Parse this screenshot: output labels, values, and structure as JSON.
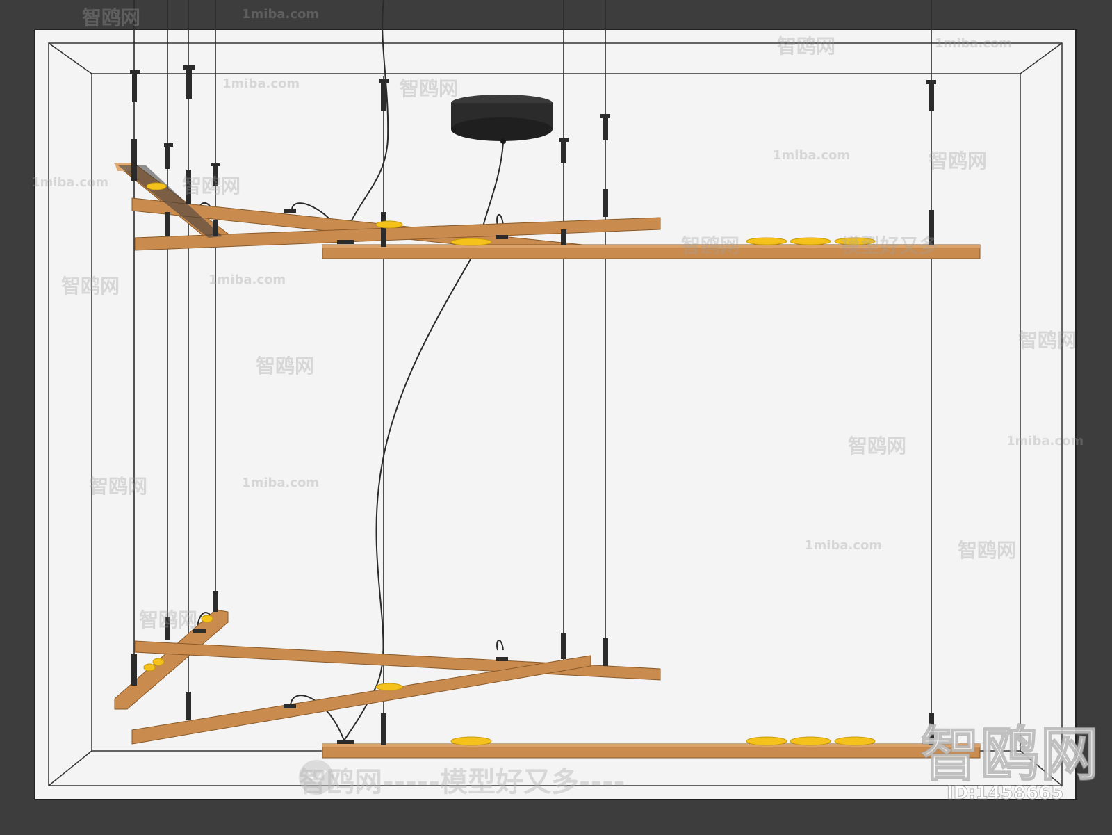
{
  "watermark": {
    "brand": "智鸥网",
    "site": "1miba.com",
    "slogan": "智鸥网-----模型好又多----",
    "slogan_short": "模型好又多",
    "id_label": "ID:1458665"
  },
  "colors": {
    "outer_frame": "#3d3d3d",
    "viewport_bg": "#f4f4f4",
    "wood": "#c98b4e",
    "wood_top": "#d9a066",
    "wood_dark": "#a86c34",
    "cable": "#2a2a2a",
    "canopy": "#2b2b2b",
    "lamp_yellow": "#f5c21c"
  },
  "icons": [
    "canopy-icon",
    "pendant-lamp-icon",
    "watermark-logo-icon"
  ]
}
